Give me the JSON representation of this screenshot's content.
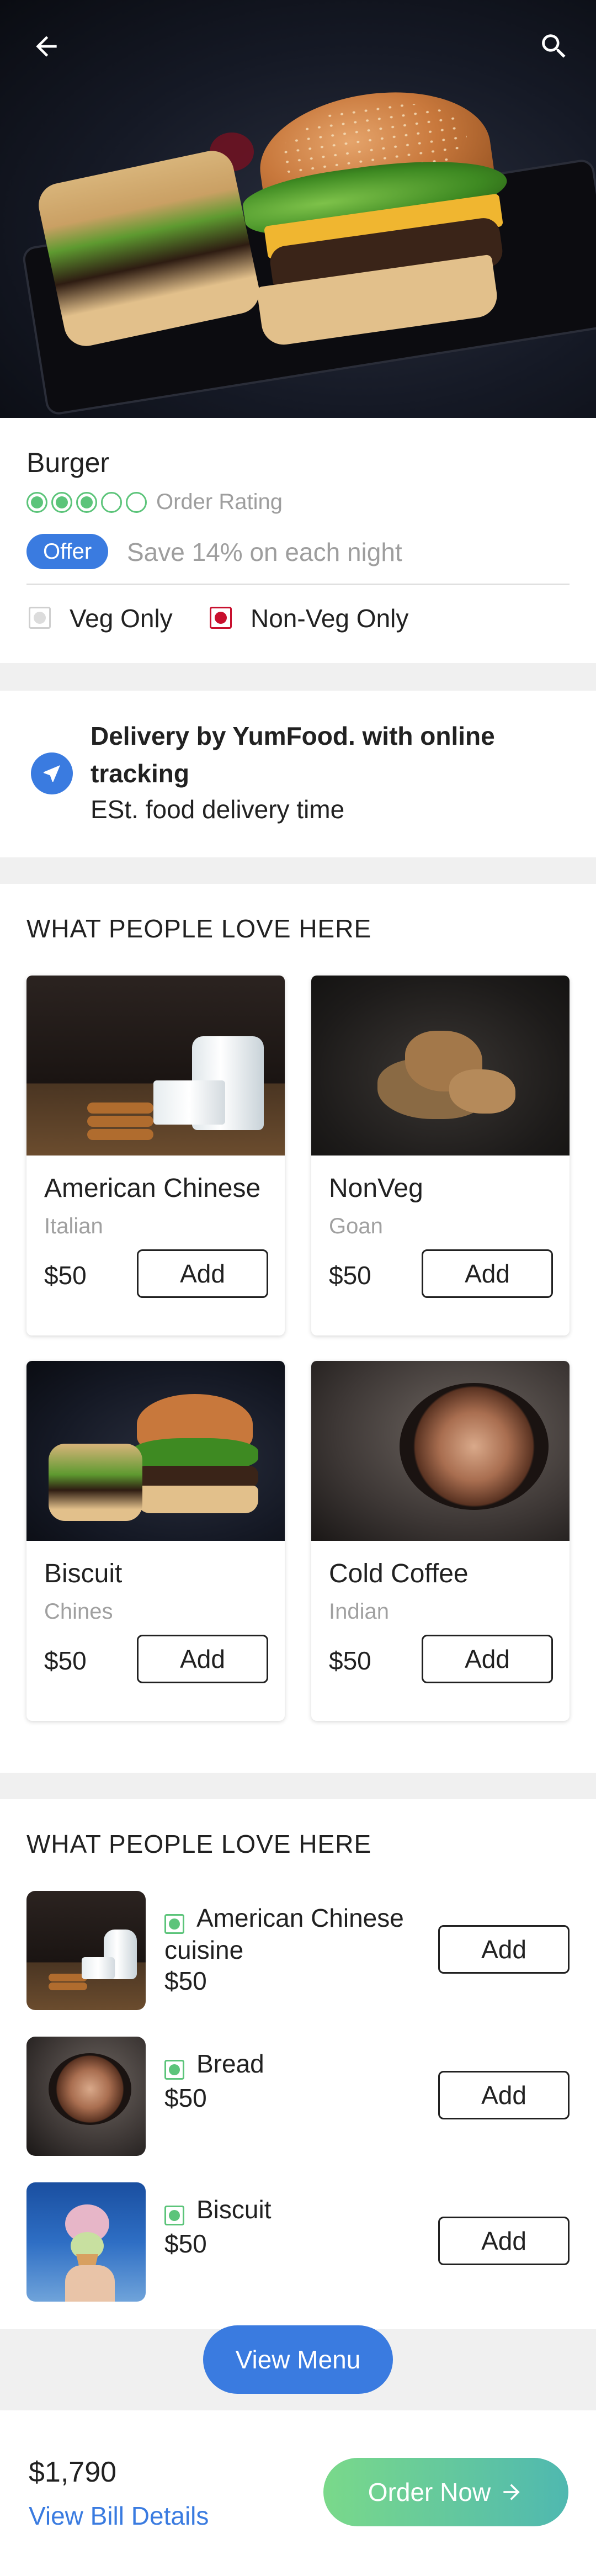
{
  "product": {
    "title": "Burger",
    "rating_label": "Order Rating",
    "rating_value": 3,
    "rating_max": 5,
    "offer_badge": "Offer",
    "offer_text": "Save 14% on each night",
    "veg_only": "Veg Only",
    "nonveg_only": "Non-Veg Only"
  },
  "delivery": {
    "title": "Delivery by YumFood. with online tracking",
    "subtitle": "ESt. food delivery time"
  },
  "section1": {
    "title": "WHAT PEOPLE LOVE HERE",
    "items": [
      {
        "name": "American Chinese",
        "category": "Italian",
        "price": "$50",
        "add": "Add"
      },
      {
        "name": "NonVeg",
        "category": "Goan",
        "price": "$50",
        "add": "Add"
      },
      {
        "name": "Biscuit",
        "category": "Chines",
        "price": "$50",
        "add": "Add"
      },
      {
        "name": "Cold Coffee",
        "category": "Indian",
        "price": "$50",
        "add": "Add"
      }
    ]
  },
  "section2": {
    "title": "WHAT PEOPLE LOVE HERE",
    "items": [
      {
        "name": "American Chinese cuisine",
        "price": "$50",
        "add": "Add"
      },
      {
        "name": "Bread",
        "price": "$50",
        "add": "Add"
      },
      {
        "name": "Biscuit",
        "price": "$50",
        "add": "Add"
      }
    ]
  },
  "footer": {
    "view_menu": "View Menu",
    "total": "$1,790",
    "bill_link": "View Bill Details",
    "order_now": "Order Now"
  },
  "colors": {
    "accent": "#3a7be0",
    "veg_green": "#5cc47a",
    "nonveg_red": "#c8102e"
  },
  "icons": {
    "back": "arrow-left-icon",
    "search": "search-icon",
    "delivery": "navigation-arrow-icon",
    "order": "arrow-right-icon"
  }
}
